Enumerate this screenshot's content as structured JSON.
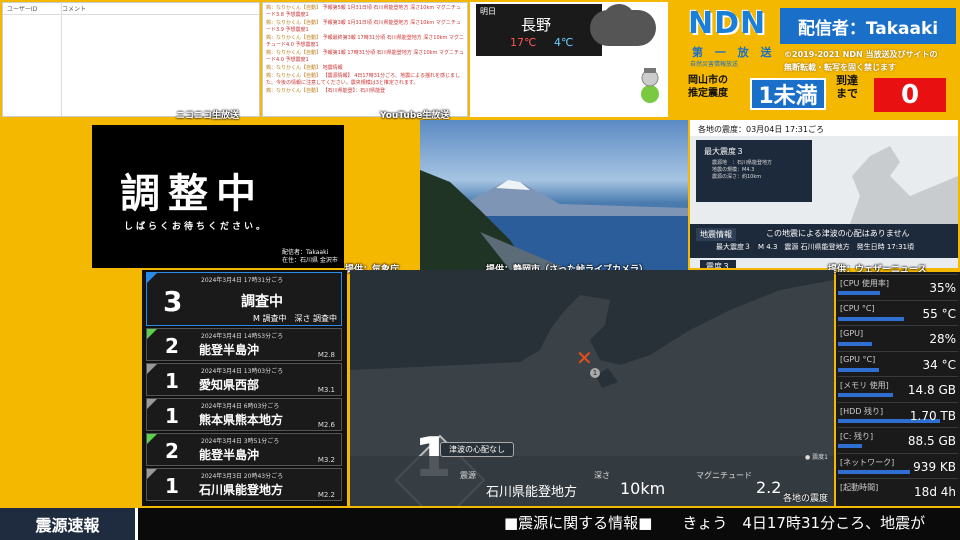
{
  "nico": {
    "col_user": "ユーザーID",
    "col_comment": "コメント",
    "source": "ニコニコ生放送"
  },
  "youtube": {
    "source": "YouTube生放送",
    "messages": [
      {
        "name": "鶏：なりかくん【自動】",
        "text": "予報第5報 1月31日頃 石川県能登地方 深さ10km マグニチュード3.8 予想震度1"
      },
      {
        "name": "鶏：なりかくん【自動】",
        "text": "予報第3報 1月31日頃 石川県能登地方 深さ10km マグニチュード3.9 予想震度1"
      },
      {
        "name": "鶏：なりかくん【自動】",
        "text": "予報最終第3報 17時31分頃 石川県能登地方 深さ10km マグニチュード4.0 予想震度1"
      },
      {
        "name": "鶏：なりかくん【自動】",
        "text": "予報第1報 17時31分頃 石川県能登地方 深さ10km マグニチュード4.0 予想震度1"
      },
      {
        "name": "鶏：なりかくん【自動】",
        "text": "地震情報"
      },
      {
        "name": "鶏：なりかくん【自動】",
        "text": "【震源情報】 4日17時31分ごろ、地震による揺れを感じました。今後の情報に注意してください。震央規模は3と推定されます。"
      },
      {
        "name": "鶏：なりかくん【自動】",
        "text": "【石川県能登】：石川県能登"
      }
    ]
  },
  "weather": {
    "day": "明日",
    "city": "長野",
    "high": "17℃",
    "low": "4℃"
  },
  "ndn": {
    "logo": "NDN",
    "broadcaster": "配信者：Takaaki",
    "channel": "第 一 放 送",
    "sub_note": "自然災害情報放送",
    "copyright_1": "©2019-2021 NDN 当放送及びサイトの",
    "copyright_2": "無断転載・転写を固く禁じます",
    "estimate_label_1": "岡山市の",
    "estimate_label_2": "推定震度",
    "estimate_value": "1未満",
    "arrival_1": "到達",
    "arrival_2": "まで",
    "arrival_count": "0"
  },
  "standby": {
    "title": "調整中",
    "sub": "しばらくお待ちください。",
    "credit_1": "配信者：Takaaki",
    "credit_2": "在住：石川県 金沢市"
  },
  "sources": {
    "jma": "提供：気象庁",
    "camera": "提供：静岡市（さった峠ライブカメラ）",
    "wni": "提供：ウェザーニュース"
  },
  "minimap": {
    "header": "各地の震度：03月04日 17:31ごろ",
    "box_title": "最大震度３",
    "box_lines": [
      "震源地　：石川県能登地方",
      "地震の規模：M4.3",
      "震源の深さ：約10km"
    ],
    "bar_tab": "地震情報",
    "bar_msg": "この地震による津波の心配はありません",
    "bar_detail": "最大震度３　M 4.3　震源 石川県能登地方　発生日時 17:31頃",
    "intensity_tab": "震度３"
  },
  "quakes": [
    {
      "datetime": "2024年3月4日 17時31分ごろ",
      "shindo": "3",
      "place": "調査中",
      "detail": "M 調査中　深さ 調査中",
      "mag": "",
      "color": "#2a8ae8"
    },
    {
      "datetime": "2024年3月4日 14時53分ごろ",
      "shindo": "2",
      "place": "能登半島沖",
      "detail": "",
      "mag": "M2.8",
      "color": "#5cd24c"
    },
    {
      "datetime": "2024年3月4日 13時03分ごろ",
      "shindo": "1",
      "place": "愛知県西部",
      "detail": "",
      "mag": "M3.1",
      "color": "#999999"
    },
    {
      "datetime": "2024年3月4日 6時03分ごろ",
      "shindo": "1",
      "place": "熊本県熊本地方",
      "detail": "",
      "mag": "M2.6",
      "color": "#999999"
    },
    {
      "datetime": "2024年3月4日 3時51分ごろ",
      "shindo": "2",
      "place": "能登半島沖",
      "detail": "",
      "mag": "M3.2",
      "color": "#5cd24c"
    },
    {
      "datetime": "2024年3月3日 20時43分ごろ",
      "shindo": "1",
      "place": "石川県能登地方",
      "detail": "",
      "mag": "M2.2",
      "color": "#999999"
    }
  ],
  "mainmap": {
    "intensity": "1",
    "tsunami": "津波の心配なし",
    "epicenter_label": "震源",
    "epicenter": "石川県能登地方",
    "depth_label": "深さ",
    "depth": "10km",
    "mag_label": "マグニチュード",
    "mag": "2.2",
    "station": "● 震度1",
    "footer": "各地の震度"
  },
  "resources": [
    {
      "label": "[CPU 使用率]",
      "value": "35%",
      "level": 0.35
    },
    {
      "label": "[CPU °C]",
      "value": "55 °C",
      "level": 0.55
    },
    {
      "label": "[GPU]",
      "value": "28%",
      "level": 0.28
    },
    {
      "label": "[GPU °C]",
      "value": "34 °C",
      "level": 0.34
    },
    {
      "label": "[メモリ 使用]",
      "value": "14.8 GB",
      "level": 0.46
    },
    {
      "label": "[HDD 残り]",
      "value": "1.70 TB",
      "level": 0.85
    },
    {
      "label": "[C: 残り]",
      "value": "88.5 GB",
      "level": 0.2
    },
    {
      "label": "[ネットワーク]",
      "value": "939 KB",
      "level": 0.6
    },
    {
      "label": "[起動時間]",
      "value": "18d 4h",
      "level": 0
    }
  ],
  "ticker": {
    "label": "震源速報",
    "text": "■震源に関する情報■　　きょう　4日17時31分ころ、地震が"
  }
}
